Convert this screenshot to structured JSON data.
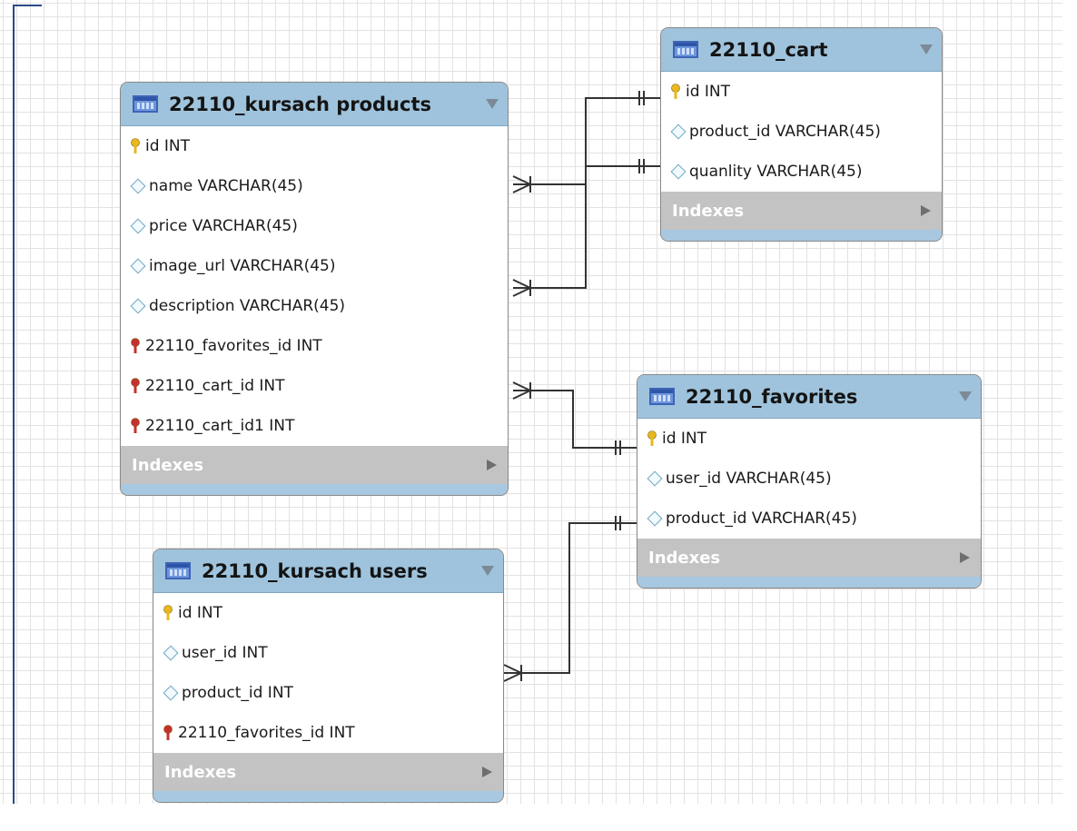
{
  "tables": {
    "products": {
      "title": "22110_kursach products",
      "columns": [
        {
          "label": "id INT",
          "kind": "pk"
        },
        {
          "label": "name VARCHAR(45)",
          "kind": "col"
        },
        {
          "label": "price VARCHAR(45)",
          "kind": "col"
        },
        {
          "label": "image_url VARCHAR(45)",
          "kind": "col"
        },
        {
          "label": "description VARCHAR(45)",
          "kind": "col"
        },
        {
          "label": "22110_favorites_id INT",
          "kind": "fk"
        },
        {
          "label": "22110_cart_id INT",
          "kind": "fk"
        },
        {
          "label": "22110_cart_id1 INT",
          "kind": "fk"
        }
      ],
      "indexes_label": "Indexes"
    },
    "cart": {
      "title": "22110_cart",
      "columns": [
        {
          "label": "id INT",
          "kind": "pk"
        },
        {
          "label": "product_id VARCHAR(45)",
          "kind": "col"
        },
        {
          "label": "quanlity VARCHAR(45)",
          "kind": "col"
        }
      ],
      "indexes_label": "Indexes"
    },
    "favorites": {
      "title": "22110_favorites",
      "columns": [
        {
          "label": "id INT",
          "kind": "pk"
        },
        {
          "label": "user_id VARCHAR(45)",
          "kind": "col"
        },
        {
          "label": "product_id VARCHAR(45)",
          "kind": "col"
        }
      ],
      "indexes_label": "Indexes"
    },
    "users": {
      "title": "22110_kursach users",
      "columns": [
        {
          "label": "id INT",
          "kind": "pk"
        },
        {
          "label": "user_id INT",
          "kind": "col"
        },
        {
          "label": "product_id INT",
          "kind": "col"
        },
        {
          "label": "22110_favorites_id INT",
          "kind": "fk"
        }
      ],
      "indexes_label": "Indexes"
    }
  },
  "relationships": [
    {
      "from": "22110_kursach products",
      "to": "22110_cart",
      "cardinality": "many-to-one"
    },
    {
      "from": "22110_kursach products",
      "to": "22110_cart",
      "cardinality": "many-to-one"
    },
    {
      "from": "22110_kursach products",
      "to": "22110_favorites",
      "cardinality": "many-to-one"
    },
    {
      "from": "22110_kursach users",
      "to": "22110_favorites",
      "cardinality": "many-to-one"
    }
  ],
  "colors": {
    "header": "#9fc3dc",
    "indexes_bar": "#c3c3c3",
    "primary_key": "#e8b81c",
    "foreign_key": "#c4322e",
    "column_icon": "#6aa6c2",
    "grid_line": "#e2e2e2",
    "relationship_line": "#333333"
  },
  "icons": {
    "table": "table-icon",
    "primary_key": "key-icon",
    "foreign_key": "foreign-key-icon",
    "column": "diamond-icon",
    "dropdown": "dropdown-arrow-icon",
    "expand": "expand-arrow-icon"
  }
}
